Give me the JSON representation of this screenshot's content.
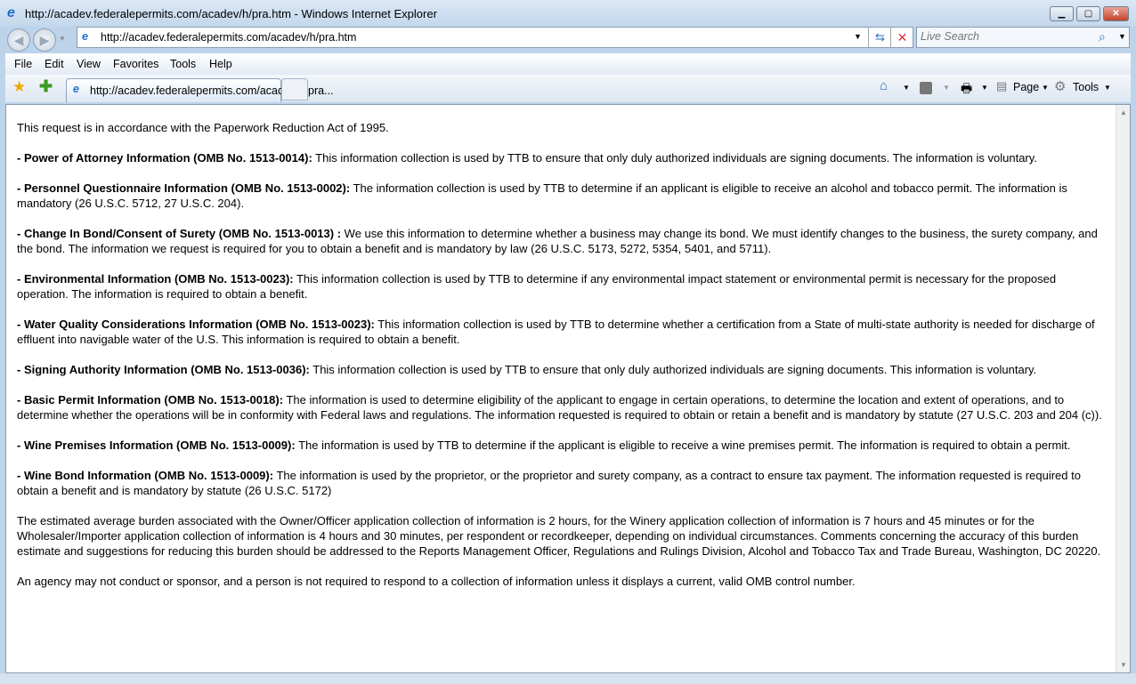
{
  "window": {
    "title": "http://acadev.federalepermits.com/acadev/h/pra.htm - Windows Internet Explorer",
    "minimize": "▁",
    "maximize": "▢",
    "close": "✕"
  },
  "nav": {
    "back": "◀",
    "forward": "▶",
    "address": "http://acadev.federalepermits.com/acadev/h/pra.htm",
    "search_placeholder": "Live Search"
  },
  "menu": [
    "File",
    "Edit",
    "View",
    "Favorites",
    "Tools",
    "Help"
  ],
  "tab": {
    "label": "http://acadev.federalepermits.com/acadev/h/pra..."
  },
  "commandbar": {
    "page": "Page",
    "tools": "Tools"
  },
  "content": {
    "intro": "This request is in accordance with the Paperwork Reduction Act of 1995.",
    "items": [
      {
        "label": "- Power of Attorney Information (OMB No. 1513-0014):",
        "text": " This information collection is used by TTB to ensure that only duly authorized individuals are signing documents. The information is voluntary."
      },
      {
        "label": "- Personnel Questionnaire Information (OMB No. 1513-0002):",
        "text": " The information collection is used by TTB to determine if an applicant is eligible to receive an alcohol and tobacco permit. The information is mandatory (26 U.S.C. 5712, 27 U.S.C. 204)."
      },
      {
        "label": "- Change In Bond/Consent of Surety (OMB No. 1513-0013) :",
        "text": " We use this information to determine whether a business may change its bond. We must identify changes to the business, the surety company, and the bond. The information we request is required for you to obtain a benefit and is mandatory by law (26 U.S.C. 5173, 5272, 5354, 5401, and 5711)."
      },
      {
        "label": "- Environmental Information (OMB No. 1513-0023):",
        "text": " This information collection is used by TTB to determine if any environmental impact statement or environmental permit is necessary for the proposed operation. The information is required to obtain a benefit."
      },
      {
        "label": "- Water Quality Considerations Information (OMB No. 1513-0023):",
        "text": " This information collection is used by TTB to determine whether a certification from a State of multi-state authority is needed for discharge of effluent into navigable water of the U.S. This information is required to obtain a benefit."
      },
      {
        "label": "- Signing Authority Information (OMB No. 1513-0036):",
        "text": " This information collection is used by TTB to ensure that only duly authorized individuals are signing documents. This information is voluntary."
      },
      {
        "label": "- Basic Permit Information (OMB No. 1513-0018):",
        "text": " The information is used to determine eligibility of the applicant to engage in certain operations, to determine the location and extent of operations, and to determine whether the operations will be in conformity with Federal laws and regulations. The information requested is required to obtain or retain a benefit and is mandatory by statute (27 U.S.C. 203 and 204 (c))."
      },
      {
        "label": "- Wine Premises Information (OMB No. 1513-0009):",
        "text": " The information is used by TTB to determine if the applicant is eligible to receive a wine premises permit. The information is required to obtain a permit."
      },
      {
        "label": "- Wine Bond Information (OMB No. 1513-0009):",
        "text": " The information is used by the proprietor, or the proprietor and surety company, as a contract to ensure tax payment. The information requested is required to obtain a benefit and is mandatory by statute (26 U.S.C. 5172)"
      }
    ],
    "burden": "The estimated average burden associated with the Owner/Officer application collection of information is 2 hours, for the Winery application collection of information is 7 hours and 45 minutes or for the Wholesaler/Importer application collection of information is 4 hours and 30 minutes, per respondent or recordkeeper, depending on individual circumstances. Comments concerning the accuracy of this burden estimate and suggestions for reducing this burden should be addressed to the Reports Management Officer, Regulations and Rulings Division, Alcohol and Tobacco Tax and Trade Bureau, Washington, DC 20220.",
    "closing": "An agency may not conduct or sponsor, and a person is not required to respond to a collection of information unless it displays a current, valid OMB control number."
  }
}
